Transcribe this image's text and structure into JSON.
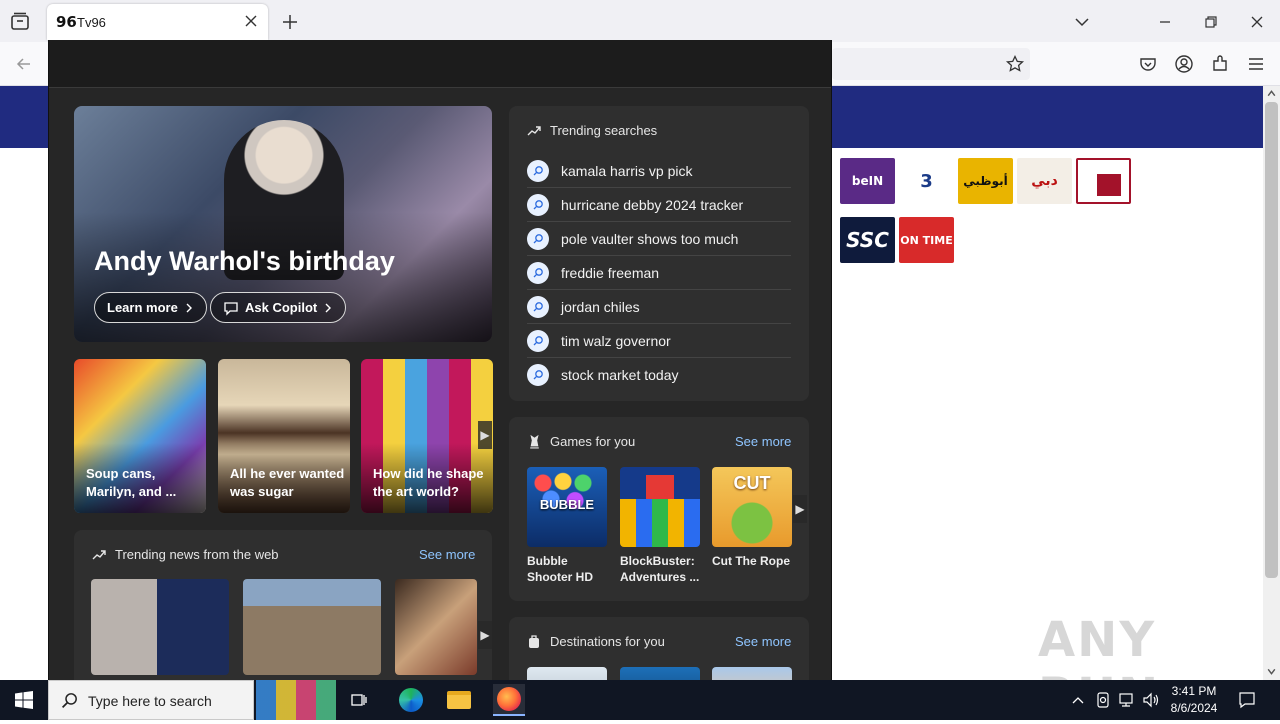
{
  "browser": {
    "tab_favicon": "96",
    "tab_title": "Tv96"
  },
  "hero": {
    "title": "Andy Warhol's birthday",
    "learn_more": "Learn more",
    "ask_copilot": "Ask Copilot"
  },
  "cards": [
    {
      "text": "Soup cans, Marilyn, and ..."
    },
    {
      "text": "All he ever wanted was sugar"
    },
    {
      "text": "How did he shape the art world?"
    }
  ],
  "trending_searches": {
    "title": "Trending searches",
    "items": [
      "kamala harris vp pick",
      "hurricane debby 2024 tracker",
      "pole vaulter shows too much",
      "freddie freeman",
      "jordan chiles",
      "tim walz governor",
      "stock market today"
    ]
  },
  "games": {
    "title": "Games for you",
    "see_more": "See more",
    "items": [
      {
        "name": "Bubble Shooter HD",
        "art": "BUBBLE"
      },
      {
        "name": "BlockBuster: Adventures ...",
        "art": ""
      },
      {
        "name": "Cut The Rope",
        "art": "CUT"
      }
    ]
  },
  "news": {
    "title": "Trending news from the web",
    "see_more": "See more"
  },
  "destinations": {
    "title": "Destinations for you",
    "see_more": "See more"
  },
  "channel_logos": [
    {
      "label": "beIN",
      "color": "#5a2a86"
    },
    {
      "label": "3",
      "color": "#ffffff"
    },
    {
      "label": "أبوظبي",
      "color": "#e9b400"
    },
    {
      "label": "دبي",
      "color": "#f3eee6"
    },
    {
      "label": "",
      "color": "#a3122a"
    },
    {
      "label": "SSC",
      "color": "#0f1b3c"
    },
    {
      "label": "ON TIME",
      "color": "#d82a2a"
    }
  ],
  "watermark": "ANY RUN",
  "taskbar": {
    "search_placeholder": "Type here to search",
    "time": "3:41 PM",
    "date": "8/6/2024"
  }
}
